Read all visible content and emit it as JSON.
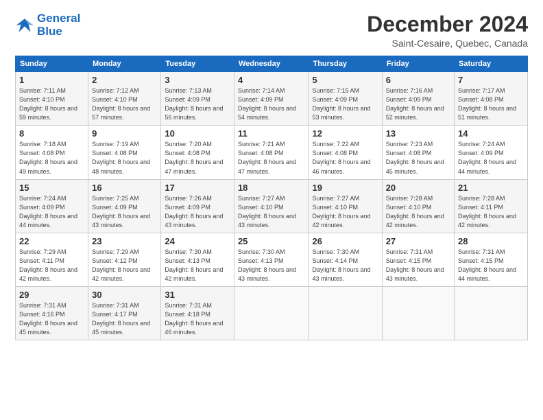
{
  "logo": {
    "line1": "General",
    "line2": "Blue"
  },
  "title": "December 2024",
  "subtitle": "Saint-Cesaire, Quebec, Canada",
  "weekdays": [
    "Sunday",
    "Monday",
    "Tuesday",
    "Wednesday",
    "Thursday",
    "Friday",
    "Saturday"
  ],
  "weeks": [
    [
      {
        "day": "1",
        "sunrise": "7:11 AM",
        "sunset": "4:10 PM",
        "daylight": "8 hours and 59 minutes."
      },
      {
        "day": "2",
        "sunrise": "7:12 AM",
        "sunset": "4:10 PM",
        "daylight": "8 hours and 57 minutes."
      },
      {
        "day": "3",
        "sunrise": "7:13 AM",
        "sunset": "4:09 PM",
        "daylight": "8 hours and 56 minutes."
      },
      {
        "day": "4",
        "sunrise": "7:14 AM",
        "sunset": "4:09 PM",
        "daylight": "8 hours and 54 minutes."
      },
      {
        "day": "5",
        "sunrise": "7:15 AM",
        "sunset": "4:09 PM",
        "daylight": "8 hours and 53 minutes."
      },
      {
        "day": "6",
        "sunrise": "7:16 AM",
        "sunset": "4:09 PM",
        "daylight": "8 hours and 52 minutes."
      },
      {
        "day": "7",
        "sunrise": "7:17 AM",
        "sunset": "4:08 PM",
        "daylight": "8 hours and 51 minutes."
      }
    ],
    [
      {
        "day": "8",
        "sunrise": "7:18 AM",
        "sunset": "4:08 PM",
        "daylight": "8 hours and 49 minutes."
      },
      {
        "day": "9",
        "sunrise": "7:19 AM",
        "sunset": "4:08 PM",
        "daylight": "8 hours and 48 minutes."
      },
      {
        "day": "10",
        "sunrise": "7:20 AM",
        "sunset": "4:08 PM",
        "daylight": "8 hours and 47 minutes."
      },
      {
        "day": "11",
        "sunrise": "7:21 AM",
        "sunset": "4:08 PM",
        "daylight": "8 hours and 47 minutes."
      },
      {
        "day": "12",
        "sunrise": "7:22 AM",
        "sunset": "4:08 PM",
        "daylight": "8 hours and 46 minutes."
      },
      {
        "day": "13",
        "sunrise": "7:23 AM",
        "sunset": "4:08 PM",
        "daylight": "8 hours and 45 minutes."
      },
      {
        "day": "14",
        "sunrise": "7:24 AM",
        "sunset": "4:09 PM",
        "daylight": "8 hours and 44 minutes."
      }
    ],
    [
      {
        "day": "15",
        "sunrise": "7:24 AM",
        "sunset": "4:09 PM",
        "daylight": "8 hours and 44 minutes."
      },
      {
        "day": "16",
        "sunrise": "7:25 AM",
        "sunset": "4:09 PM",
        "daylight": "8 hours and 43 minutes."
      },
      {
        "day": "17",
        "sunrise": "7:26 AM",
        "sunset": "4:09 PM",
        "daylight": "8 hours and 43 minutes."
      },
      {
        "day": "18",
        "sunrise": "7:27 AM",
        "sunset": "4:10 PM",
        "daylight": "8 hours and 43 minutes."
      },
      {
        "day": "19",
        "sunrise": "7:27 AM",
        "sunset": "4:10 PM",
        "daylight": "8 hours and 42 minutes."
      },
      {
        "day": "20",
        "sunrise": "7:28 AM",
        "sunset": "4:10 PM",
        "daylight": "8 hours and 42 minutes."
      },
      {
        "day": "21",
        "sunrise": "7:28 AM",
        "sunset": "4:11 PM",
        "daylight": "8 hours and 42 minutes."
      }
    ],
    [
      {
        "day": "22",
        "sunrise": "7:29 AM",
        "sunset": "4:11 PM",
        "daylight": "8 hours and 42 minutes."
      },
      {
        "day": "23",
        "sunrise": "7:29 AM",
        "sunset": "4:12 PM",
        "daylight": "8 hours and 42 minutes."
      },
      {
        "day": "24",
        "sunrise": "7:30 AM",
        "sunset": "4:13 PM",
        "daylight": "8 hours and 42 minutes."
      },
      {
        "day": "25",
        "sunrise": "7:30 AM",
        "sunset": "4:13 PM",
        "daylight": "8 hours and 43 minutes."
      },
      {
        "day": "26",
        "sunrise": "7:30 AM",
        "sunset": "4:14 PM",
        "daylight": "8 hours and 43 minutes."
      },
      {
        "day": "27",
        "sunrise": "7:31 AM",
        "sunset": "4:15 PM",
        "daylight": "8 hours and 43 minutes."
      },
      {
        "day": "28",
        "sunrise": "7:31 AM",
        "sunset": "4:15 PM",
        "daylight": "8 hours and 44 minutes."
      }
    ],
    [
      {
        "day": "29",
        "sunrise": "7:31 AM",
        "sunset": "4:16 PM",
        "daylight": "8 hours and 45 minutes."
      },
      {
        "day": "30",
        "sunrise": "7:31 AM",
        "sunset": "4:17 PM",
        "daylight": "8 hours and 45 minutes."
      },
      {
        "day": "31",
        "sunrise": "7:31 AM",
        "sunset": "4:18 PM",
        "daylight": "8 hours and 46 minutes."
      },
      null,
      null,
      null,
      null
    ]
  ]
}
